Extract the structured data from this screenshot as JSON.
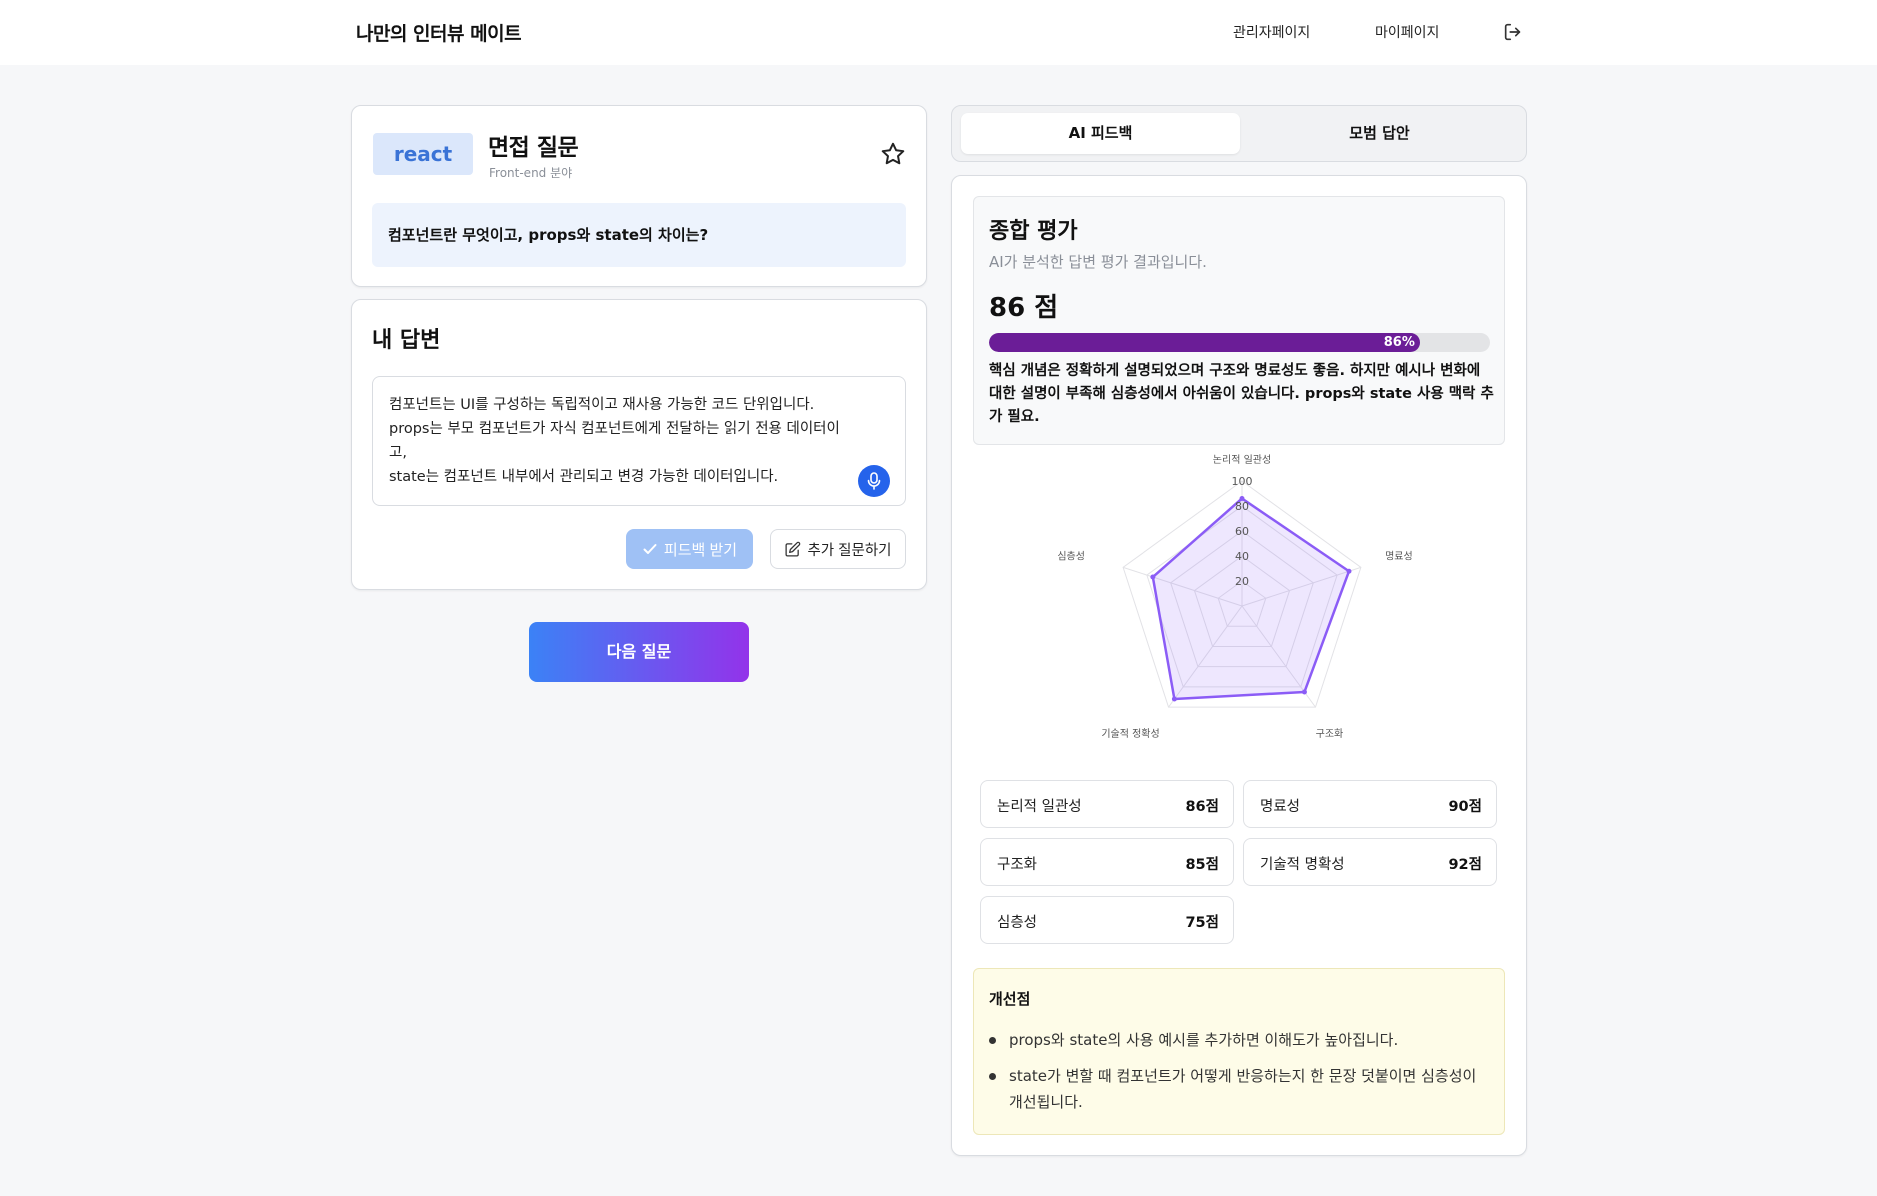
{
  "header": {
    "brand": "나만의 인터뷰 메이트",
    "nav": {
      "admin": "관리자페이지",
      "mypage": "마이페이지"
    },
    "logout_icon": "logout-icon"
  },
  "question": {
    "tag": "react",
    "title": "면접 질문",
    "subtitle": "Front-end 분야",
    "text": "컴포넌트란 무엇이고, props와 state의 차이는?",
    "favorite_icon": "star-icon"
  },
  "answer": {
    "title": "내 답변",
    "lines": [
      "컴포넌트는 UI를 구성하는 독립적이고 재사용 가능한 코드 단위입니다.",
      "props는 부모 컴포넌트가 자식 컴포넌트에게 전달하는 읽기 전용 데이터이",
      "고,",
      "state는 컴포넌트 내부에서 관리되고 변경 가능한 데이터입니다."
    ],
    "feedback_button": "피드백 받기",
    "followup_button": "추가 질문하기"
  },
  "next_button": "다음 질문",
  "tabs": {
    "ai": "AI 피드백",
    "model": "모범 답안",
    "active": "ai"
  },
  "summary": {
    "title": "종합 평가",
    "subtitle": "AI가 분석한 답변 평가 결과입니다.",
    "score_text": "86 점",
    "progress": 86,
    "progress_label": "86%",
    "text": "핵심 개념은 정확하게 설명되었으며 구조와 명료성도 좋음. 하지만 예시나 변화에 대한 설명이 부족해 심층성에서 아쉬움이 있습니다. props와 state 사용 맥락 추가 필요.",
    "accent": "#6b1d97"
  },
  "chart_data": {
    "type": "radar",
    "axes": [
      "논리적 일관성",
      "명료성",
      "구조화",
      "기술적 정확성",
      "심층성"
    ],
    "ticks": [
      "20",
      "40",
      "60",
      "80",
      "100"
    ],
    "range": [
      0,
      100
    ],
    "values": [
      86,
      90,
      85,
      92,
      75
    ],
    "color": "#8b5cf6"
  },
  "metrics": [
    {
      "label": "논리적 일관성",
      "value": "86점"
    },
    {
      "label": "명료성",
      "value": "90점"
    },
    {
      "label": "구조화",
      "value": "85점"
    },
    {
      "label": "기술적 명확성",
      "value": "92점"
    },
    {
      "label": "심층성",
      "value": "75점"
    }
  ],
  "improvements": {
    "title": "개선점",
    "items": [
      "props와 state의 사용 예시를 추가하면 이해도가 높아집니다.",
      "state가 변할 때 컴포넌트가 어떻게 반응하는지 한 문장 덧붙이면 심층성이 개선됩니다."
    ]
  }
}
